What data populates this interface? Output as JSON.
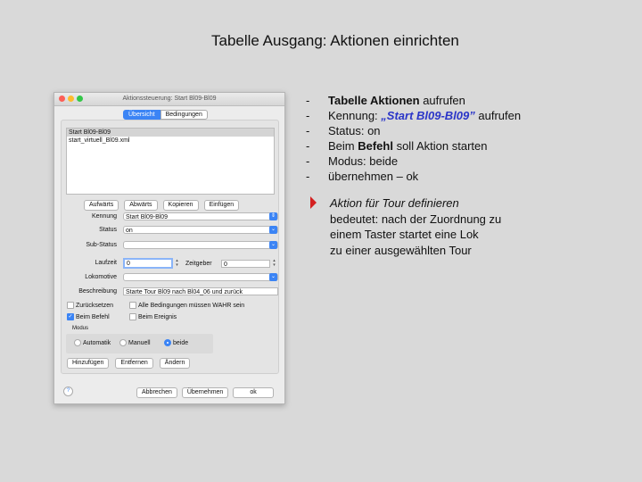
{
  "slide": {
    "title": "Tabelle Ausgang:  Aktionen einrichten"
  },
  "dialog": {
    "title": "Aktionssteuerung: Start Bl09-Bl09",
    "tabs": [
      "Übersicht",
      "Bedingungen"
    ],
    "list_items": [
      "Start Bl09-Bl09",
      "start_virtuell_Bl09.xml"
    ],
    "list_buttons": [
      "Aufwärts",
      "Abwärts",
      "Kopieren",
      "Einfügen"
    ],
    "fields": {
      "kennung_label": "Kennung",
      "kennung_value": "Start Bl09-Bl09",
      "status_label": "Status",
      "status_value": "on",
      "substatus_label": "Sub-Status",
      "substatus_value": "",
      "laufzeit_label": "Laufzeit",
      "laufzeit_value": "0",
      "zeitgeber_label": "Zeitgeber",
      "zeitgeber_value": "0",
      "lokomotive_label": "Lokomotive",
      "lokomotive_value": "",
      "beschreibung_label": "Beschreibung",
      "beschreibung_value": "Starte Tour Bl09 nach Bl04_06 und zurück"
    },
    "checkboxes": {
      "zuruecksetzen": "Zurücksetzen",
      "alle_bedingungen": "Alle Bedingungen müssen WAHR sein",
      "beim_befehl": "Beim Befehl",
      "beim_ereignis": "Beim Ereignis"
    },
    "modus": {
      "label": "Modus",
      "options": [
        "Automatik",
        "Manuell",
        "beide"
      ],
      "selected": "beide"
    },
    "bottom_buttons": [
      "Hinzufügen",
      "Entfernen",
      "Ändern"
    ],
    "footer_buttons": [
      "Abbrechen",
      "Übernehmen",
      "ok"
    ],
    "help": "?"
  },
  "bullets": [
    {
      "bold": "Tabelle Aktionen",
      "rest": " aufrufen"
    },
    {
      "pre": "Kennung: ",
      "blue": "„Start Bl09-Bl09”",
      "rest": " aufrufen"
    },
    {
      "pre": "Status: on"
    },
    {
      "pre": "Beim ",
      "bold": "Befehl",
      "rest": " soll Aktion starten"
    },
    {
      "pre": "Modus: beide"
    },
    {
      "pre": "übernehmen – ok"
    }
  ],
  "bullet_dash": "-",
  "callout": {
    "heading": "Aktion für Tour definieren",
    "lines": [
      "bedeutet: nach der Zuordnung zu",
      "einem Taster startet eine Lok",
      "zu einer ausgewählten Tour"
    ]
  },
  "colors": {
    "accent": "#3b84f5",
    "link_blue": "#2a35c8",
    "arrow_red": "#d42020"
  }
}
